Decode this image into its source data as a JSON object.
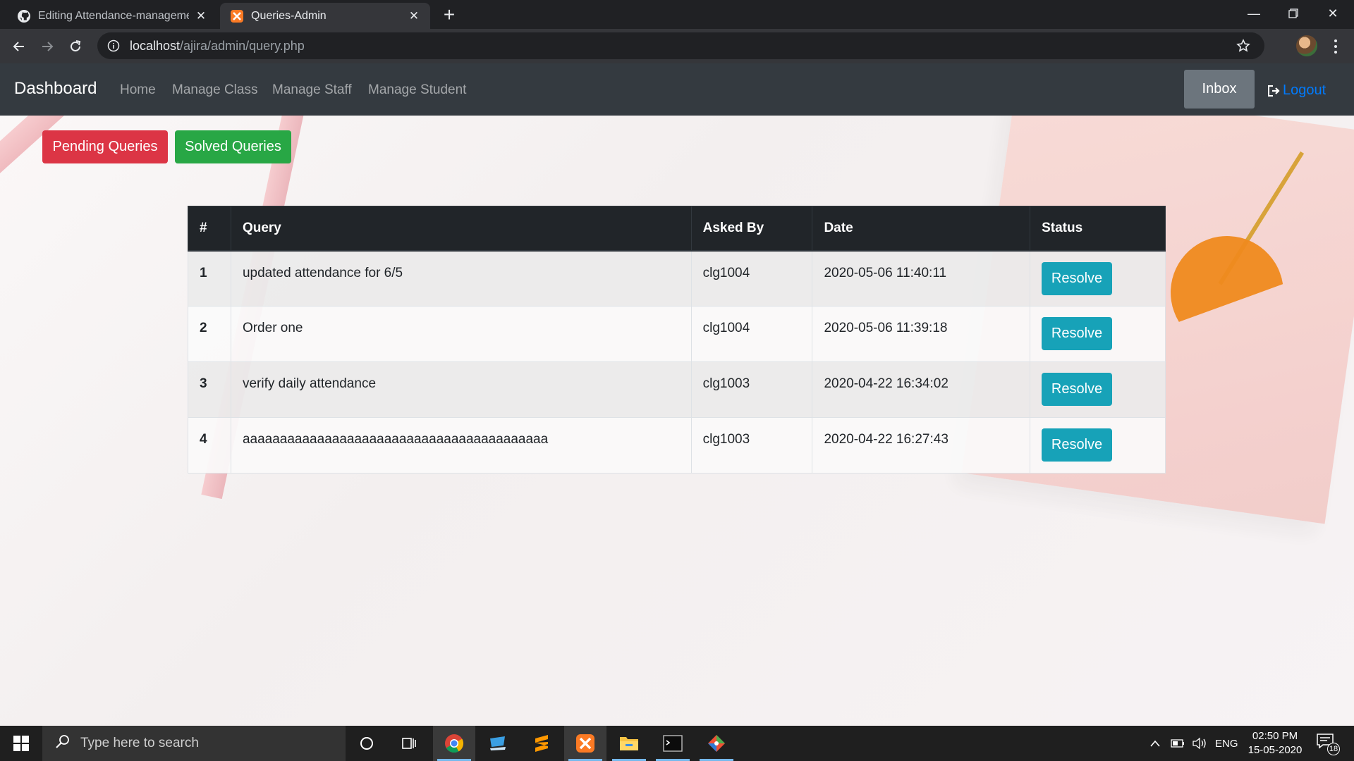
{
  "browser": {
    "tabs": [
      {
        "title": "Editing Attendance-management-system",
        "icon": "github-icon",
        "active": false
      },
      {
        "title": "Queries-Admin",
        "icon": "xampp-icon",
        "active": true
      }
    ],
    "url_host": "localhost",
    "url_path": "/ajira/admin/query.php"
  },
  "navbar": {
    "brand": "Dashboard",
    "links": [
      "Home",
      "Manage Class",
      "Manage Staff",
      "Manage Student"
    ],
    "inbox": "Inbox",
    "logout": "Logout"
  },
  "actions": {
    "pending": "Pending Queries",
    "solved": "Solved Queries"
  },
  "table": {
    "headers": [
      "#",
      "Query",
      "Asked By",
      "Date",
      "Status"
    ],
    "rows": [
      {
        "num": "1",
        "query": "updated attendance for 6/5",
        "asked_by": "clg1004",
        "date": "2020-05-06 11:40:11",
        "status": "Resolve"
      },
      {
        "num": "2",
        "query": "Order one",
        "asked_by": "clg1004",
        "date": "2020-05-06 11:39:18",
        "status": "Resolve"
      },
      {
        "num": "3",
        "query": "verify daily attendance",
        "asked_by": "clg1003",
        "date": "2020-04-22 16:34:02",
        "status": "Resolve"
      },
      {
        "num": "4",
        "query": "aaaaaaaaaaaaaaaaaaaaaaaaaaaaaaaaaaaaaaaaa",
        "asked_by": "clg1003",
        "date": "2020-04-22 16:27:43",
        "status": "Resolve"
      }
    ]
  },
  "taskbar": {
    "search_placeholder": "Type here to search",
    "lang": "ENG",
    "time": "02:50 PM",
    "date": "15-05-2020",
    "notifications": "18"
  },
  "colors": {
    "danger": "#dc3545",
    "success": "#28a745",
    "info": "#17a2b8",
    "link": "#007bff",
    "navbar": "#343a40"
  }
}
